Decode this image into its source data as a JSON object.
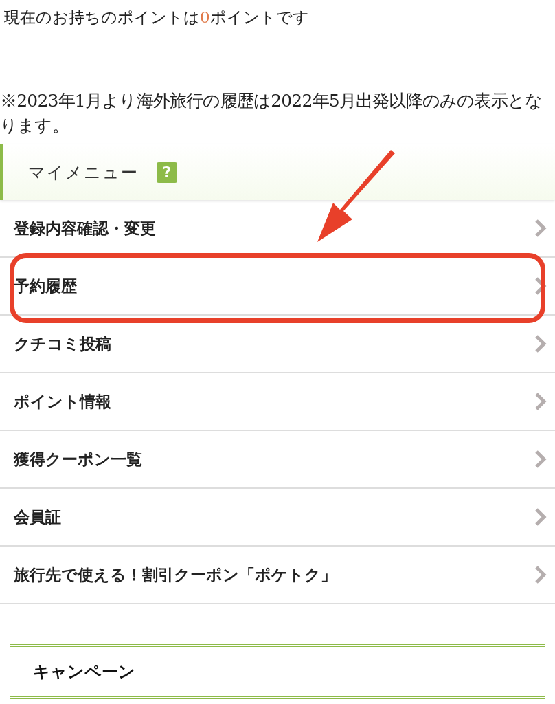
{
  "points_line": {
    "before": "現在のお持ちのポイントは",
    "value": "0",
    "after": "ポイントです"
  },
  "notice": "※2023年1月より海外旅行の履歴は2022年5月出発以降のみの表示となります。",
  "my_menu": {
    "title": "マイメニュー",
    "help_icon": "?",
    "items": [
      {
        "label": "登録内容確認・変更",
        "highlighted": false
      },
      {
        "label": "予約履歴",
        "highlighted": true
      },
      {
        "label": "クチコミ投稿",
        "highlighted": false
      },
      {
        "label": "ポイント情報",
        "highlighted": false
      },
      {
        "label": "獲得クーポン一覧",
        "highlighted": false
      },
      {
        "label": "会員証",
        "highlighted": false
      },
      {
        "label": "旅行先で使える！割引クーポン「ポケトク」",
        "highlighted": false
      }
    ]
  },
  "campaign": {
    "title": "キャンペーン"
  }
}
